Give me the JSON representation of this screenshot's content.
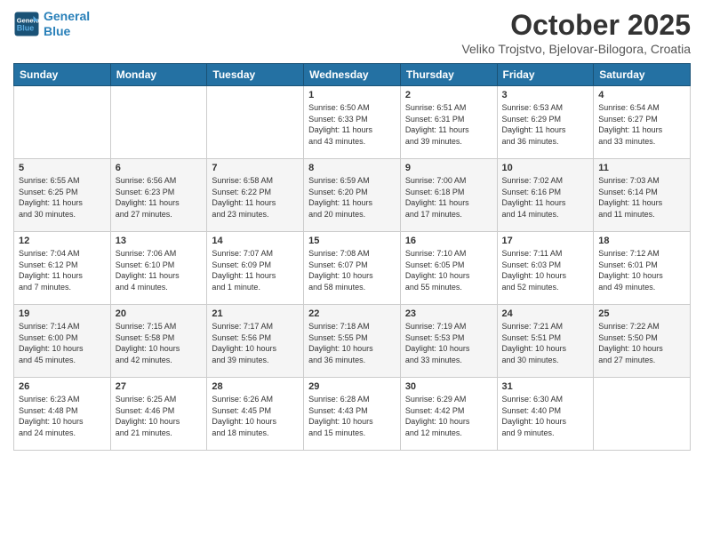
{
  "header": {
    "logo_line1": "General",
    "logo_line2": "Blue",
    "title": "October 2025",
    "subtitle": "Veliko Trojstvo, Bjelovar-Bilogora, Croatia"
  },
  "weekdays": [
    "Sunday",
    "Monday",
    "Tuesday",
    "Wednesday",
    "Thursday",
    "Friday",
    "Saturday"
  ],
  "weeks": [
    [
      {
        "day": "",
        "info": ""
      },
      {
        "day": "",
        "info": ""
      },
      {
        "day": "",
        "info": ""
      },
      {
        "day": "1",
        "info": "Sunrise: 6:50 AM\nSunset: 6:33 PM\nDaylight: 11 hours\nand 43 minutes."
      },
      {
        "day": "2",
        "info": "Sunrise: 6:51 AM\nSunset: 6:31 PM\nDaylight: 11 hours\nand 39 minutes."
      },
      {
        "day": "3",
        "info": "Sunrise: 6:53 AM\nSunset: 6:29 PM\nDaylight: 11 hours\nand 36 minutes."
      },
      {
        "day": "4",
        "info": "Sunrise: 6:54 AM\nSunset: 6:27 PM\nDaylight: 11 hours\nand 33 minutes."
      }
    ],
    [
      {
        "day": "5",
        "info": "Sunrise: 6:55 AM\nSunset: 6:25 PM\nDaylight: 11 hours\nand 30 minutes."
      },
      {
        "day": "6",
        "info": "Sunrise: 6:56 AM\nSunset: 6:23 PM\nDaylight: 11 hours\nand 27 minutes."
      },
      {
        "day": "7",
        "info": "Sunrise: 6:58 AM\nSunset: 6:22 PM\nDaylight: 11 hours\nand 23 minutes."
      },
      {
        "day": "8",
        "info": "Sunrise: 6:59 AM\nSunset: 6:20 PM\nDaylight: 11 hours\nand 20 minutes."
      },
      {
        "day": "9",
        "info": "Sunrise: 7:00 AM\nSunset: 6:18 PM\nDaylight: 11 hours\nand 17 minutes."
      },
      {
        "day": "10",
        "info": "Sunrise: 7:02 AM\nSunset: 6:16 PM\nDaylight: 11 hours\nand 14 minutes."
      },
      {
        "day": "11",
        "info": "Sunrise: 7:03 AM\nSunset: 6:14 PM\nDaylight: 11 hours\nand 11 minutes."
      }
    ],
    [
      {
        "day": "12",
        "info": "Sunrise: 7:04 AM\nSunset: 6:12 PM\nDaylight: 11 hours\nand 7 minutes."
      },
      {
        "day": "13",
        "info": "Sunrise: 7:06 AM\nSunset: 6:10 PM\nDaylight: 11 hours\nand 4 minutes."
      },
      {
        "day": "14",
        "info": "Sunrise: 7:07 AM\nSunset: 6:09 PM\nDaylight: 11 hours\nand 1 minute."
      },
      {
        "day": "15",
        "info": "Sunrise: 7:08 AM\nSunset: 6:07 PM\nDaylight: 10 hours\nand 58 minutes."
      },
      {
        "day": "16",
        "info": "Sunrise: 7:10 AM\nSunset: 6:05 PM\nDaylight: 10 hours\nand 55 minutes."
      },
      {
        "day": "17",
        "info": "Sunrise: 7:11 AM\nSunset: 6:03 PM\nDaylight: 10 hours\nand 52 minutes."
      },
      {
        "day": "18",
        "info": "Sunrise: 7:12 AM\nSunset: 6:01 PM\nDaylight: 10 hours\nand 49 minutes."
      }
    ],
    [
      {
        "day": "19",
        "info": "Sunrise: 7:14 AM\nSunset: 6:00 PM\nDaylight: 10 hours\nand 45 minutes."
      },
      {
        "day": "20",
        "info": "Sunrise: 7:15 AM\nSunset: 5:58 PM\nDaylight: 10 hours\nand 42 minutes."
      },
      {
        "day": "21",
        "info": "Sunrise: 7:17 AM\nSunset: 5:56 PM\nDaylight: 10 hours\nand 39 minutes."
      },
      {
        "day": "22",
        "info": "Sunrise: 7:18 AM\nSunset: 5:55 PM\nDaylight: 10 hours\nand 36 minutes."
      },
      {
        "day": "23",
        "info": "Sunrise: 7:19 AM\nSunset: 5:53 PM\nDaylight: 10 hours\nand 33 minutes."
      },
      {
        "day": "24",
        "info": "Sunrise: 7:21 AM\nSunset: 5:51 PM\nDaylight: 10 hours\nand 30 minutes."
      },
      {
        "day": "25",
        "info": "Sunrise: 7:22 AM\nSunset: 5:50 PM\nDaylight: 10 hours\nand 27 minutes."
      }
    ],
    [
      {
        "day": "26",
        "info": "Sunrise: 6:23 AM\nSunset: 4:48 PM\nDaylight: 10 hours\nand 24 minutes."
      },
      {
        "day": "27",
        "info": "Sunrise: 6:25 AM\nSunset: 4:46 PM\nDaylight: 10 hours\nand 21 minutes."
      },
      {
        "day": "28",
        "info": "Sunrise: 6:26 AM\nSunset: 4:45 PM\nDaylight: 10 hours\nand 18 minutes."
      },
      {
        "day": "29",
        "info": "Sunrise: 6:28 AM\nSunset: 4:43 PM\nDaylight: 10 hours\nand 15 minutes."
      },
      {
        "day": "30",
        "info": "Sunrise: 6:29 AM\nSunset: 4:42 PM\nDaylight: 10 hours\nand 12 minutes."
      },
      {
        "day": "31",
        "info": "Sunrise: 6:30 AM\nSunset: 4:40 PM\nDaylight: 10 hours\nand 9 minutes."
      },
      {
        "day": "",
        "info": ""
      }
    ]
  ]
}
